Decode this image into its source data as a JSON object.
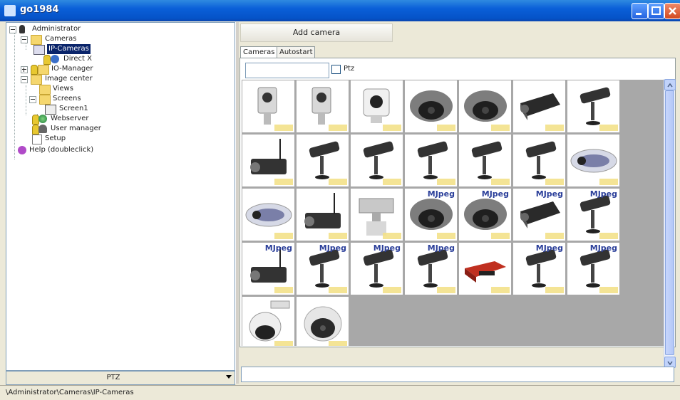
{
  "window": {
    "title": "go1984"
  },
  "tree": {
    "items": [
      {
        "label": "Administrator",
        "icon": "admin-icon"
      },
      {
        "label": "Cameras",
        "icon": "folder-icon"
      },
      {
        "label": "IP-Cameras",
        "icon": "ip-camera-icon",
        "selected": true
      },
      {
        "label": "Direct X",
        "icon": "directx-icon"
      },
      {
        "label": "IO-Manager",
        "icon": "folder-icon"
      },
      {
        "label": "Image center",
        "icon": "folder-icon"
      },
      {
        "label": "Views",
        "icon": "folder-icon"
      },
      {
        "label": "Screens",
        "icon": "folder-icon"
      },
      {
        "label": "Screen1",
        "icon": "screen-icon"
      },
      {
        "label": "Webserver",
        "icon": "globe-icon"
      },
      {
        "label": "User manager",
        "icon": "user-manager-icon"
      },
      {
        "label": "Setup",
        "icon": "setup-icon"
      },
      {
        "label": "Help (doubleclick)",
        "icon": "help-icon"
      }
    ]
  },
  "ptz": {
    "label": "PTZ"
  },
  "status": {
    "path": "\\Administrator\\Cameras\\IP-Cameras"
  },
  "toolbar": {
    "add_camera": "Add camera"
  },
  "tabs": [
    {
      "label": "Cameras"
    },
    {
      "label": "Autostart"
    }
  ],
  "filter": {
    "search_value": "",
    "ptz_label": "Ptz"
  },
  "cameras": [
    {
      "type": "cube",
      "mjpeg": ""
    },
    {
      "type": "cube",
      "mjpeg": ""
    },
    {
      "type": "cube-white",
      "mjpeg": ""
    },
    {
      "type": "dome",
      "mjpeg": ""
    },
    {
      "type": "dome",
      "mjpeg": ""
    },
    {
      "type": "box-dark",
      "mjpeg": ""
    },
    {
      "type": "bullet",
      "mjpeg": ""
    },
    {
      "type": "box-antenna",
      "mjpeg": ""
    },
    {
      "type": "bullet",
      "mjpeg": ""
    },
    {
      "type": "bullet",
      "mjpeg": ""
    },
    {
      "type": "bullet",
      "mjpeg": ""
    },
    {
      "type": "bullet",
      "mjpeg": ""
    },
    {
      "type": "bullet",
      "mjpeg": ""
    },
    {
      "type": "oval",
      "mjpeg": ""
    },
    {
      "type": "oval",
      "mjpeg": ""
    },
    {
      "type": "box-antenna",
      "mjpeg": ""
    },
    {
      "type": "ptz-housing",
      "mjpeg": ""
    },
    {
      "type": "dome",
      "mjpeg": "MJpeg"
    },
    {
      "type": "dome",
      "mjpeg": "MJpeg"
    },
    {
      "type": "box-dark",
      "mjpeg": "MJpeg"
    },
    {
      "type": "bullet",
      "mjpeg": "MJpeg"
    },
    {
      "type": "box-antenna",
      "mjpeg": "MJpeg"
    },
    {
      "type": "bullet",
      "mjpeg": "MJpeg"
    },
    {
      "type": "bullet",
      "mjpeg": "MJpeg"
    },
    {
      "type": "bullet",
      "mjpeg": "MJpeg"
    },
    {
      "type": "red-box",
      "mjpeg": ""
    },
    {
      "type": "bullet",
      "mjpeg": "MJpeg"
    },
    {
      "type": "bullet",
      "mjpeg": "MJpeg"
    },
    {
      "type": "speed-dome",
      "mjpeg": ""
    },
    {
      "type": "speed-dome2",
      "mjpeg": ""
    }
  ],
  "colors": {
    "selection": "#0a246a",
    "title_bar": "#0553c8",
    "grid_background": "#a8a8a8",
    "mjpeg_text": "#2b3f9a"
  }
}
